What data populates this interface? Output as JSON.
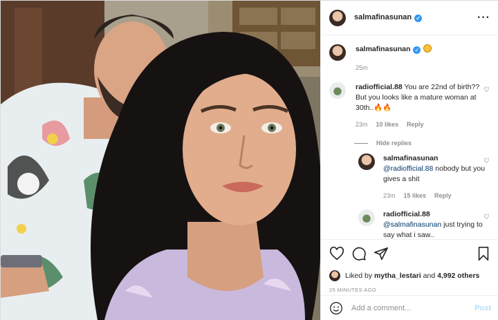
{
  "post": {
    "username": "salmafinasunan"
  },
  "caption": {
    "username": "salmafinasunan",
    "time": "25m"
  },
  "comments": [
    {
      "username": "radiofficial.88",
      "text": "You are 22nd of birth?? But you looks like a mature woman at 30th..",
      "time": "23m",
      "likes": "10 likes",
      "reply_label": "Reply"
    }
  ],
  "hide_replies": "Hide replies",
  "replies": [
    {
      "username": "salmafinasunan",
      "mention": "@radiofficial.88",
      "text": "nobody but you gives a shit",
      "time": "23m",
      "likes": "15 likes",
      "reply_label": "Reply"
    },
    {
      "username": "radiofficial.88",
      "mention": "@salmafinasunan",
      "text": "just trying to say what i saw..",
      "time": "",
      "likes": "",
      "reply_label": ""
    }
  ],
  "likes": {
    "prefix": "Liked by",
    "user": "mytha_lestari",
    "and": "and",
    "others": "4,992 others"
  },
  "timestamp": "25 MINUTES AGO",
  "add_comment": {
    "placeholder": "Add a comment...",
    "post_label": "Post"
  },
  "icons": [
    "heart-icon",
    "comment-icon",
    "share-icon",
    "bookmark-icon",
    "more-icon",
    "verified-badge-icon",
    "smiley-icon"
  ],
  "colors": {
    "link": "#00376b",
    "verified": "#3897f0",
    "post_disabled": "#b2dffc",
    "muted": "#8e8e8e"
  }
}
